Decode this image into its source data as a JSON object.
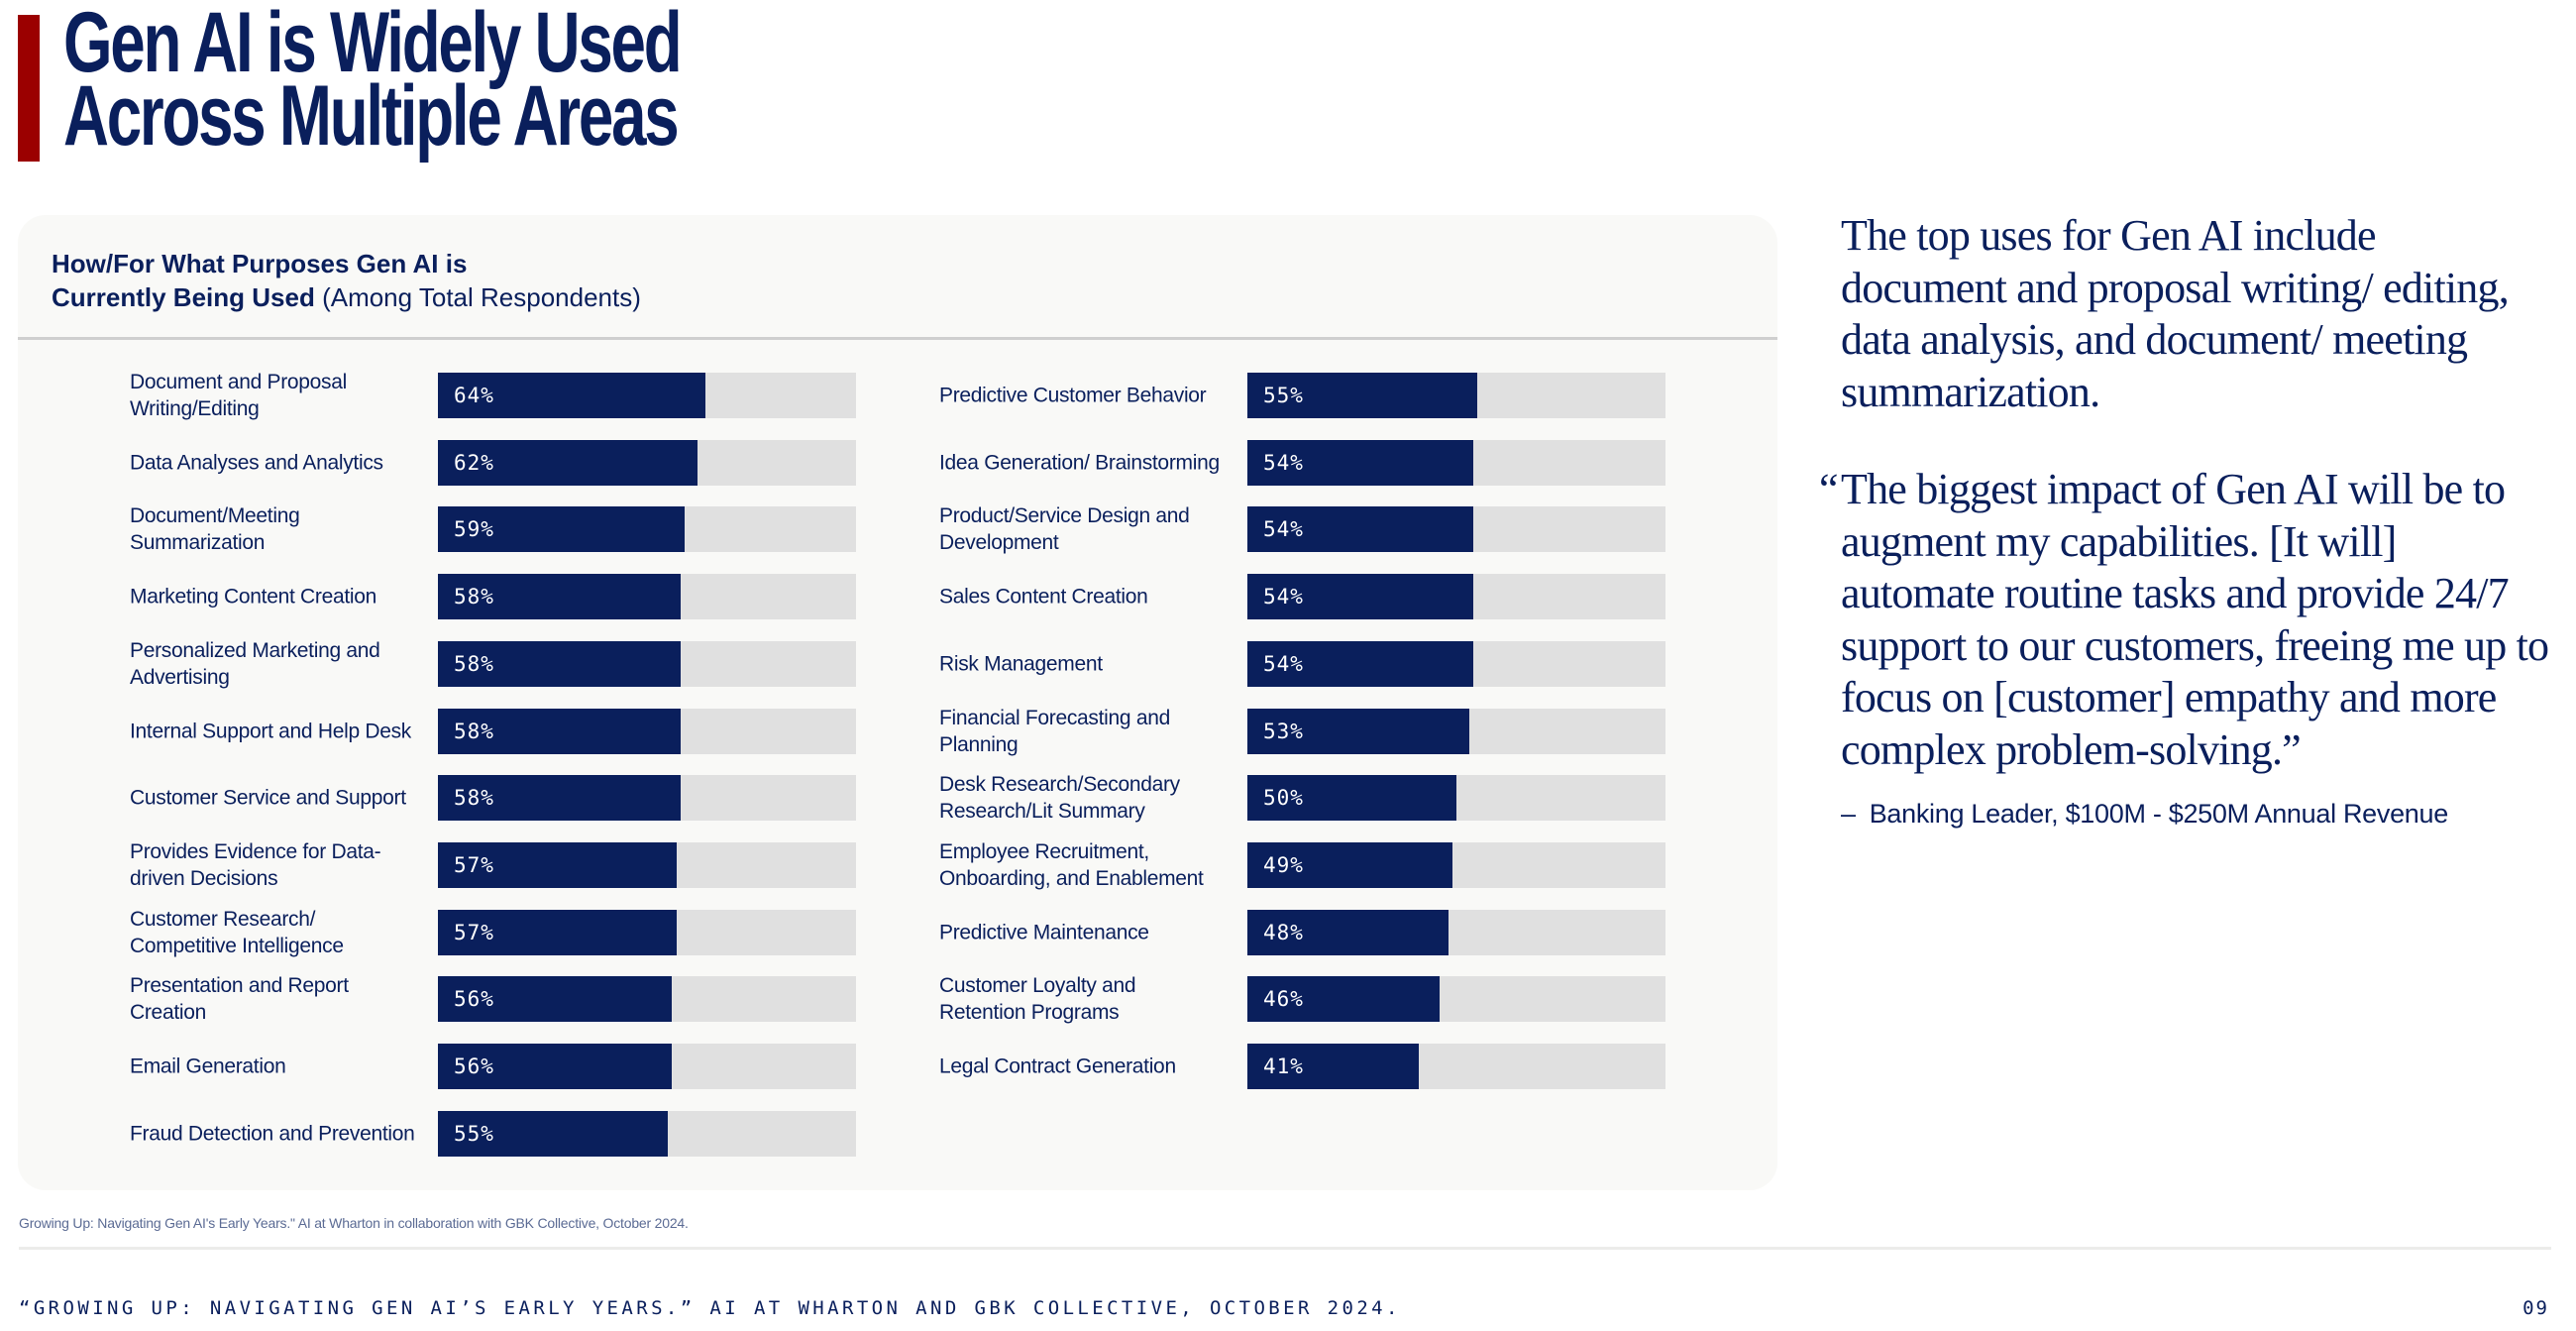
{
  "page": {
    "title_lines": [
      "Gen AI is Widely Used",
      "Across Multiple Areas"
    ],
    "accent_color": "#9b0000",
    "brand_color": "#0a1f5c",
    "page_number": "09"
  },
  "chart_card": {
    "title_bold_line1": "How/For What Purposes Gen AI is",
    "title_bold_line2": "Currently Being Used",
    "title_subtitle": "(Among Total Respondents)"
  },
  "chart_data": {
    "type": "bar",
    "orientation": "horizontal",
    "title": "How/For What Purposes Gen AI is Currently Being Used (Among Total Respondents)",
    "xlabel": "",
    "ylabel": "",
    "xlim": [
      0,
      100
    ],
    "unit": "%",
    "grid": false,
    "bar_color": "#0a1f5c",
    "track_color": "#e0e0e0",
    "columns": [
      {
        "categories": [
          "Document and Proposal Writing/Editing",
          "Data Analyses and Analytics",
          "Document/Meeting Summarization",
          "Marketing Content Creation",
          "Personalized Marketing and Advertising",
          "Internal Support and Help Desk",
          "Customer Service and Support",
          "Provides Evidence for Data-driven Decisions",
          "Customer Research/ Competitive Intelligence",
          "Presentation and Report Creation",
          "Email Generation",
          "Fraud Detection and Prevention"
        ],
        "values": [
          64,
          62,
          59,
          58,
          58,
          58,
          58,
          57,
          57,
          56,
          56,
          55
        ]
      },
      {
        "categories": [
          "Predictive Customer Behavior",
          "Idea Generation/ Brainstorming",
          "Product/Service Design and Development",
          "Sales Content Creation",
          "Risk Management",
          "Financial Forecasting and Planning",
          "Desk Research/Secondary Research/Lit Summary",
          "Employee Recruitment, Onboarding, and Enablement",
          "Predictive Maintenance",
          "Customer Loyalty and Retention Programs",
          "Legal Contract Generation"
        ],
        "values": [
          55,
          54,
          54,
          54,
          54,
          53,
          50,
          49,
          48,
          46,
          41
        ]
      }
    ]
  },
  "sidebar": {
    "summary": "The top uses for Gen AI include document and proposal writing/ editing, data analysis, and document/ meeting summarization.",
    "quote_open": "“",
    "quote": "The biggest impact of Gen AI will be to augment my capabilities. [It will] automate routine tasks and provide 24/7 support to our customers, freeing me up to focus on [customer] empathy and more complex problem-solving.”",
    "attribution_dash": "–",
    "attribution": "Banking Leader, $100M - $250M  Annual Revenue"
  },
  "footer": {
    "source": "Growing Up: Navigating Gen AI's Early Years.\" AI at Wharton in collaboration with GBK Collective, October 2024.",
    "citation": "“GROWING UP: NAVIGATING GEN AI’S EARLY YEARS.” AI AT WHARTON AND GBK COLLECTIVE, OCTOBER 2024."
  }
}
